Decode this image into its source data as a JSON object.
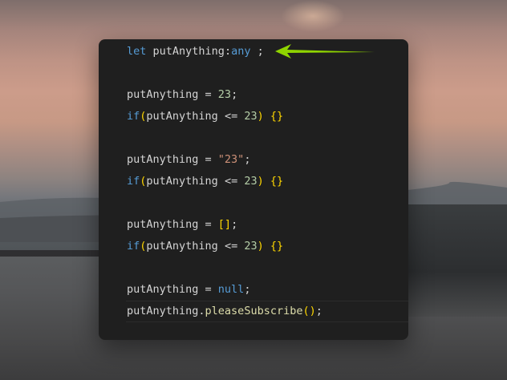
{
  "code": {
    "lines": [
      [
        {
          "t": "let",
          "c": "kw"
        },
        {
          "t": " putAnything",
          "c": "id"
        },
        {
          "t": ":",
          "c": "id"
        },
        {
          "t": "any",
          "c": "kw"
        },
        {
          "t": " ;",
          "c": "id"
        }
      ],
      [],
      [
        {
          "t": "putAnything = ",
          "c": "id"
        },
        {
          "t": "23",
          "c": "num"
        },
        {
          "t": ";",
          "c": "id"
        }
      ],
      [
        {
          "t": "if",
          "c": "ctl"
        },
        {
          "t": "(",
          "c": "br1"
        },
        {
          "t": "putAnything <= ",
          "c": "id"
        },
        {
          "t": "23",
          "c": "num"
        },
        {
          "t": ")",
          "c": "br1"
        },
        {
          "t": " ",
          "c": "id"
        },
        {
          "t": "{}",
          "c": "br1"
        }
      ],
      [],
      [
        {
          "t": "putAnything = ",
          "c": "id"
        },
        {
          "t": "\"23\"",
          "c": "str"
        },
        {
          "t": ";",
          "c": "id"
        }
      ],
      [
        {
          "t": "if",
          "c": "ctl"
        },
        {
          "t": "(",
          "c": "br1"
        },
        {
          "t": "putAnything <= ",
          "c": "id"
        },
        {
          "t": "23",
          "c": "num"
        },
        {
          "t": ")",
          "c": "br1"
        },
        {
          "t": " ",
          "c": "id"
        },
        {
          "t": "{}",
          "c": "br1"
        }
      ],
      [],
      [
        {
          "t": "putAnything = ",
          "c": "id"
        },
        {
          "t": "[]",
          "c": "br1"
        },
        {
          "t": ";",
          "c": "id"
        }
      ],
      [
        {
          "t": "if",
          "c": "ctl"
        },
        {
          "t": "(",
          "c": "br1"
        },
        {
          "t": "putAnything <= ",
          "c": "id"
        },
        {
          "t": "23",
          "c": "num"
        },
        {
          "t": ")",
          "c": "br1"
        },
        {
          "t": " ",
          "c": "id"
        },
        {
          "t": "{}",
          "c": "br1"
        }
      ],
      [],
      [
        {
          "t": "putAnything = ",
          "c": "id"
        },
        {
          "t": "null",
          "c": "kw"
        },
        {
          "t": ";",
          "c": "id"
        }
      ],
      [
        {
          "t": "putAnything.",
          "c": "id"
        },
        {
          "t": "pleaseSubscribe",
          "c": "fn"
        },
        {
          "t": "()",
          "c": "br1"
        },
        {
          "t": ";",
          "c": "id"
        }
      ]
    ]
  },
  "annotation": {
    "icon": "arrow-left-icon",
    "color": "#8fd400"
  }
}
